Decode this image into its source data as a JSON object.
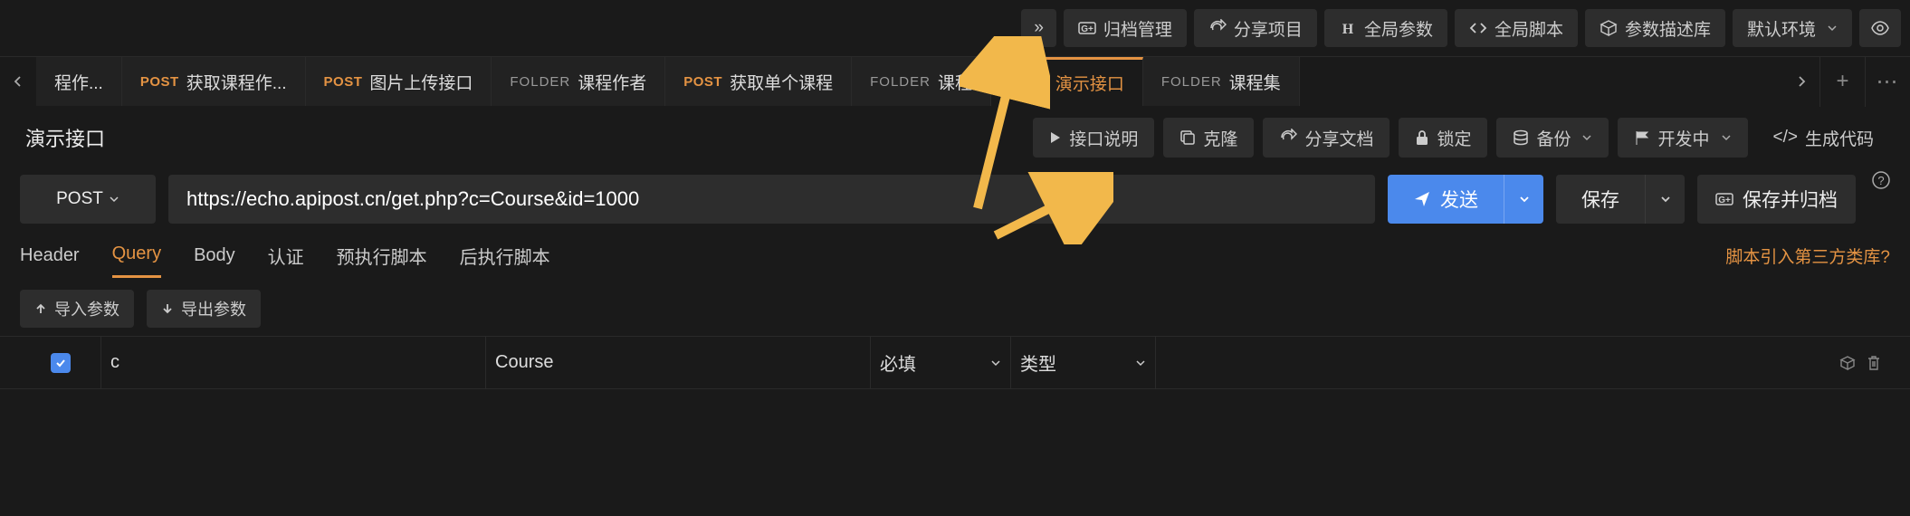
{
  "top_toolbar": {
    "more": "»",
    "buttons": [
      {
        "id": "archive-manage",
        "label": "归档管理",
        "icon": "g-plus"
      },
      {
        "id": "share-project",
        "label": "分享项目",
        "icon": "share"
      },
      {
        "id": "global-params",
        "label": "全局参数",
        "icon": "letter-h"
      },
      {
        "id": "global-scripts",
        "label": "全局脚本",
        "icon": "code"
      },
      {
        "id": "param-desc-lib",
        "label": "参数描述库",
        "icon": "cube"
      },
      {
        "id": "env",
        "label": "默认环境",
        "icon": null,
        "dropdown": true
      }
    ],
    "preview_icon": "eye"
  },
  "tabs": [
    {
      "method": null,
      "folder": false,
      "label": "程作..."
    },
    {
      "method": "POST",
      "folder": false,
      "label": "获取课程作..."
    },
    {
      "method": "POST",
      "folder": false,
      "label": "图片上传接口"
    },
    {
      "method": null,
      "folder": true,
      "label": "课程作者"
    },
    {
      "method": "POST",
      "folder": false,
      "label": "获取单个课程"
    },
    {
      "method": null,
      "folder": true,
      "label": "课程"
    },
    {
      "method": "POST",
      "folder": false,
      "label": "演示接口",
      "active": true
    },
    {
      "method": null,
      "folder": true,
      "label": "课程集"
    }
  ],
  "tab_folder_prefix": "FOLDER",
  "tab_method_post": "POST",
  "tab_nav": {
    "add": "+",
    "more": "⋯"
  },
  "doc": {
    "title": "演示接口",
    "actions": {
      "api_desc": "接口说明",
      "clone": "克隆",
      "share_doc": "分享文档",
      "lock": "锁定",
      "backup": "备份",
      "status": "开发中",
      "gen_code": "生成代码"
    }
  },
  "request": {
    "method": "POST",
    "url": "https://echo.apipost.cn/get.php?c=Course&id=1000",
    "send": "发送",
    "save": "保存",
    "save_archive": "保存并归档"
  },
  "sub_tabs": {
    "items": [
      "Header",
      "Query",
      "Body",
      "认证",
      "预执行脚本",
      "后执行脚本"
    ],
    "active_index": 1,
    "right_link": "脚本引入第三方类库?"
  },
  "io": {
    "import": "导入参数",
    "export": "导出参数"
  },
  "params": {
    "rows": [
      {
        "checked": true,
        "key": "c",
        "value": "Course",
        "required_label": "必填",
        "type_label": "类型"
      }
    ]
  },
  "generic": {
    "code_prefix": "</>"
  }
}
